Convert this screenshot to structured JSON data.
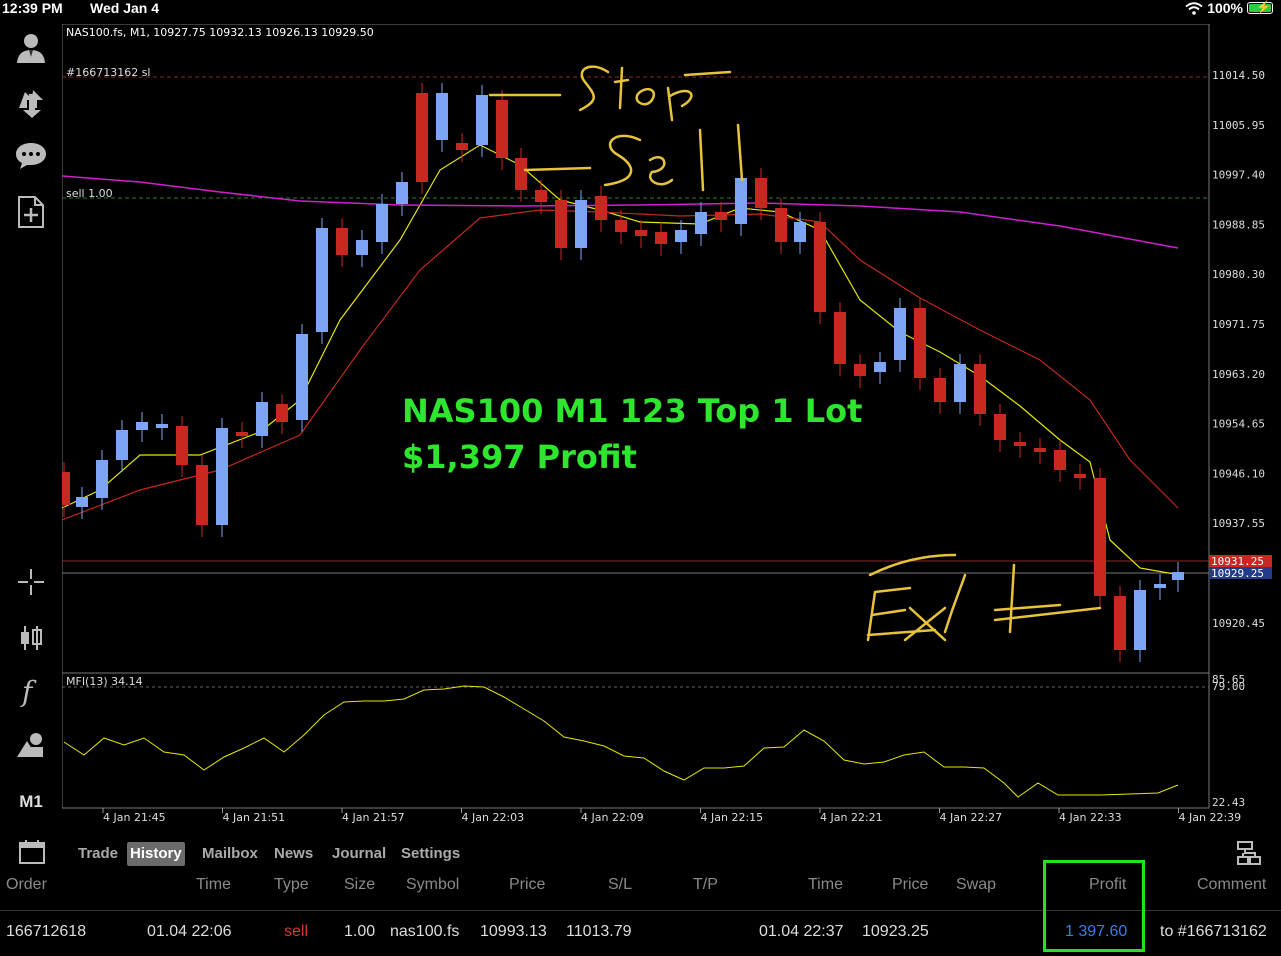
{
  "status_bar": {
    "time": "12:39 PM",
    "date": "Wed Jan 4",
    "battery": "100%",
    "wifi_icon": "wifi-icon",
    "battery_icon": "battery-charging-icon"
  },
  "toolbar": {
    "icons": [
      "account-icon",
      "trade-icon",
      "chat-icon",
      "new-document-icon",
      "crosshair-icon",
      "candlestick-icon",
      "function-icon",
      "objects-icon"
    ],
    "timeframe": "M1"
  },
  "chart": {
    "info": "NAS100.fs, M1, 10927.75 10932.13 10926.13 10929.50",
    "order_label": "#166713162 sl",
    "sell_label": "sell 1.00",
    "mfi_label": "MFI(13) 34.14",
    "price_ticks": [
      "11014.50",
      "11005.95",
      "10997.40",
      "10988.85",
      "10980.30",
      "10971.75",
      "10963.20",
      "10954.65",
      "10946.10",
      "10937.55",
      "10920.45"
    ],
    "price_tags": {
      "red": "10931.25",
      "blue": "10929.25"
    },
    "mfi_ticks": [
      "85.65",
      "79.00",
      "22.43"
    ],
    "time_ticks": [
      "4 Jan 21:45",
      "4 Jan 21:51",
      "4 Jan 21:57",
      "4 Jan 22:03",
      "4 Jan 22:09",
      "4 Jan 22:15",
      "4 Jan 22:21",
      "4 Jan 22:27",
      "4 Jan 22:33",
      "4 Jan 22:39"
    ],
    "overlay_line1": "NAS100 M1 123 Top 1 Lot",
    "overlay_line2": "$1,397 Profit",
    "colors": {
      "bull": "#7ea4f5",
      "bear": "#c8281f",
      "ma_fast": "#e6e600",
      "ma_slow": "#c0281c",
      "ma_long": "#d01fd0",
      "annotation": "#e6c33a",
      "overlay": "#2ee62e"
    }
  },
  "tabs": {
    "calendar_icon": "calendar-icon",
    "items": [
      "Trade",
      "History",
      "Mailbox",
      "News",
      "Journal",
      "Settings"
    ],
    "active": "History",
    "layout_icon": "layout-icon"
  },
  "history": {
    "headers": [
      "Order",
      "Time",
      "Type",
      "Size",
      "Symbol",
      "Price",
      "S/L",
      "T/P",
      "Time",
      "Price",
      "Swap",
      "Profit",
      "Comment"
    ],
    "row": {
      "order": "166712618",
      "open_time": "01.04 22:06",
      "type": "sell",
      "size": "1.00",
      "symbol": "nas100.fs",
      "open_price": "10993.13",
      "sl": "11013.79",
      "tp": "",
      "close_time": "01.04 22:37",
      "close_price": "10923.25",
      "swap": "",
      "profit": "1 397.60",
      "comment": "to #166713162"
    }
  }
}
